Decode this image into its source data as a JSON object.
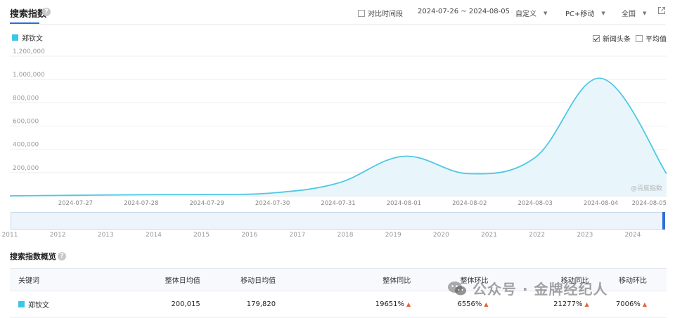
{
  "header": {
    "title": "搜索指数",
    "compare_label": "对比时间段",
    "date_range": "2024-07-26 ~ 2024-08-05",
    "period": "自定义",
    "device": "PC+移动",
    "region": "全国"
  },
  "legend": {
    "keyword": "郑钦文",
    "color": "#3ec5e6"
  },
  "options": {
    "news_label": "新闻头条",
    "news_checked": true,
    "avg_label": "平均值",
    "avg_checked": false
  },
  "chart_data": {
    "type": "area",
    "title": "",
    "xlabel": "",
    "ylabel": "",
    "x": [
      "2024-07-26",
      "2024-07-27",
      "2024-07-28",
      "2024-07-29",
      "2024-07-30",
      "2024-07-31",
      "2024-08-01",
      "2024-08-02",
      "2024-08-03",
      "2024-08-04",
      "2024-08-05"
    ],
    "x_tick_labels": [
      "2024-07-27",
      "2024-07-28",
      "2024-07-29",
      "2024-07-30",
      "2024-07-31",
      "2024-08-01",
      "2024-08-02",
      "2024-08-03",
      "2024-08-04",
      "2024-08-05"
    ],
    "series": [
      {
        "name": "郑钦文",
        "color": "#4fc8e3",
        "values": [
          0,
          5000,
          10000,
          12000,
          25000,
          110000,
          340000,
          190000,
          330000,
          1010000,
          190000
        ]
      }
    ],
    "ylim": [
      0,
      1200000
    ],
    "y_ticks": [
      200000,
      400000,
      600000,
      800000,
      1000000,
      1200000
    ],
    "y_tick_labels": [
      "200,000",
      "400,000",
      "600,000",
      "800,000",
      "1,000,000",
      "1,200,000"
    ],
    "grid": true,
    "watermark": "@百度指数"
  },
  "range_years": [
    "2011",
    "2012",
    "2013",
    "2014",
    "2015",
    "2016",
    "2017",
    "2018",
    "2019",
    "2020",
    "2021",
    "2022",
    "2023",
    "2024"
  ],
  "summary": {
    "title": "搜索指数概览",
    "headers": [
      "关键词",
      "整体日均值",
      "移动日均值",
      "整体同比",
      "整体环比",
      "移动同比",
      "移动环比"
    ],
    "row": {
      "keyword": "郑钦文",
      "overall_avg": "200,015",
      "mobile_avg": "179,820",
      "overall_yoy": "19651%",
      "overall_mom": "6556%",
      "mobile_yoy": "21277%",
      "mobile_mom": "7006%"
    }
  },
  "watermark": {
    "text": "公众号 · 金牌经纪人"
  }
}
